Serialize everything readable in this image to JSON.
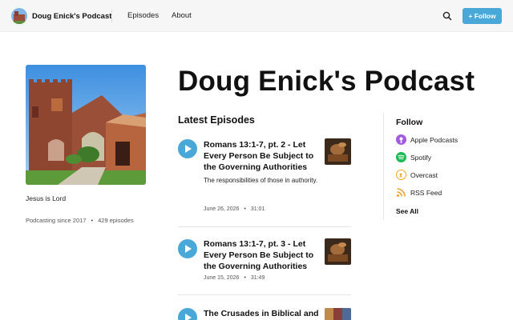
{
  "header": {
    "brand_name": "Doug Enick's Podcast",
    "nav": [
      "Episodes",
      "About"
    ],
    "follow_button": "+ Follow"
  },
  "podcast": {
    "title": "Doug Enick's Podcast",
    "tagline": "Jesus is Lord",
    "since": "Podcasting since 2017",
    "episode_count": "429 episodes"
  },
  "latest": {
    "heading": "Latest Episodes",
    "episodes": [
      {
        "title": "Romans 13:1-7, pt. 2 - Let Every Person Be Subject to the Governing Authorities",
        "description": "The responsibilities of those in authority.",
        "date": "June 26, 2026",
        "duration": "31:01"
      },
      {
        "title": "Romans 13:1-7, pt. 3 - Let Every Person Be Subject to the Governing Authorities",
        "description": "",
        "date": "June 15, 2026",
        "duration": "31:49"
      },
      {
        "title": "The Crusades in Biblical and",
        "description": "",
        "date": "",
        "duration": ""
      }
    ]
  },
  "follow": {
    "heading": "Follow",
    "items": [
      {
        "label": "Apple Podcasts",
        "icon": "apple-podcasts-icon",
        "color": "#a45ae0"
      },
      {
        "label": "Spotify",
        "icon": "spotify-icon",
        "color": "#1db954"
      },
      {
        "label": "Overcast",
        "icon": "overcast-icon",
        "color": "#f5a623"
      },
      {
        "label": "RSS Feed",
        "icon": "rss-icon",
        "color": "#f0a030"
      }
    ],
    "see_all": "See All"
  },
  "colors": {
    "accent": "#4aa8d8",
    "header_bg": "#f6f6f6"
  }
}
